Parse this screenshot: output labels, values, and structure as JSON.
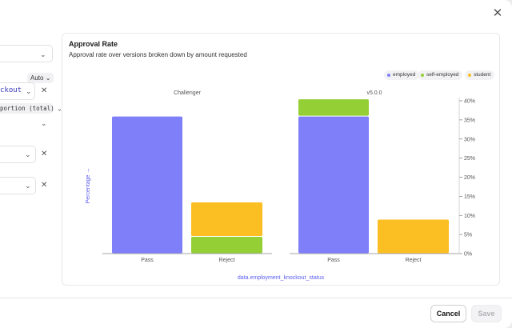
{
  "window": {
    "close_icon": "close-icon"
  },
  "left_panel": {
    "field_text": "ckout_s",
    "auto_label": "Auto",
    "aggregation_label": "portion (total)"
  },
  "card": {
    "title": "Approval Rate",
    "subtitle": "Approval rate over versions broken down by amount requested"
  },
  "legend": [
    {
      "label": "employed",
      "color": "#7f7ffa"
    },
    {
      "label": "self-employed",
      "color": "#94cf36"
    },
    {
      "label": "student",
      "color": "#fbbf24"
    }
  ],
  "buttons": {
    "cancel": "Cancel",
    "save": "Save"
  },
  "chart_data": {
    "type": "bar",
    "stacked": true,
    "panels": [
      "Challenger",
      "v5.0.0"
    ],
    "categories": [
      "Pass",
      "Reject"
    ],
    "series": [
      {
        "name": "employed",
        "color": "#7f7ffa",
        "values": [
          [
            36,
            0
          ],
          [
            36,
            0
          ]
        ]
      },
      {
        "name": "self-employed",
        "color": "#94cf36",
        "values": [
          [
            0,
            4.5
          ],
          [
            4.5,
            0
          ]
        ]
      },
      {
        "name": "student",
        "color": "#fbbf24",
        "values": [
          [
            0,
            9
          ],
          [
            0,
            9
          ]
        ]
      }
    ],
    "ylabel": "Percentage →",
    "xlabel": "data.employment_knockout_status",
    "yticks": [
      "0%",
      "5%",
      "10%",
      "15%",
      "20%",
      "25%",
      "30%",
      "35%",
      "40%"
    ],
    "ylim": [
      0,
      40
    ]
  }
}
